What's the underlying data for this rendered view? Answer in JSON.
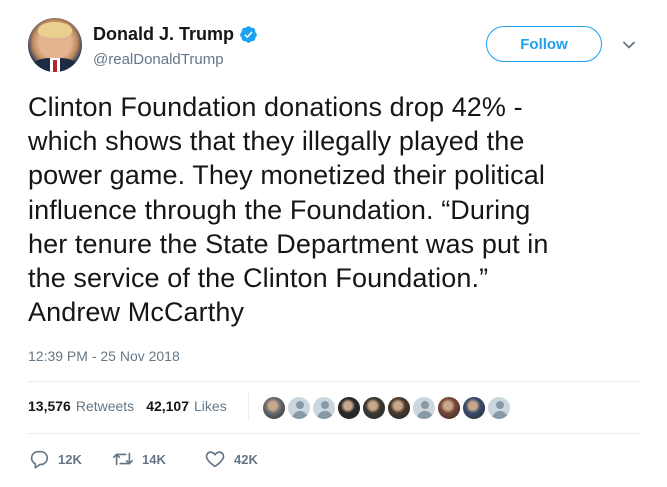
{
  "header": {
    "display_name": "Donald J. Trump",
    "handle": "@realDonaldTrump",
    "follow_label": "Follow",
    "verified": true
  },
  "tweet": {
    "lines": [
      "Clinton Foundation donations drop 42% -",
      "which shows that they illegally played the",
      "power game. They monetized their political",
      "influence through the Foundation. “During",
      "her tenure the State Department was put in",
      "the service of the Clinton Foundation.”",
      "Andrew McCarthy"
    ],
    "timestamp": "12:39 PM - 25 Nov 2018"
  },
  "stats": {
    "retweets_count": "13,576",
    "retweets_label": "Retweets",
    "likes_count": "42,107",
    "likes_label": "Likes"
  },
  "liker_avatars": [
    {
      "kind": "photo",
      "color": "#6b6e73"
    },
    {
      "kind": "default"
    },
    {
      "kind": "default"
    },
    {
      "kind": "photo",
      "color": "#2a2a2a"
    },
    {
      "kind": "photo",
      "color": "#3d3a33"
    },
    {
      "kind": "photo",
      "color": "#4a3b2c"
    },
    {
      "kind": "default"
    },
    {
      "kind": "photo",
      "color": "#7a4a3a"
    },
    {
      "kind": "photo",
      "color": "#3b4f6e"
    },
    {
      "kind": "default"
    }
  ],
  "actions": {
    "reply_count": "12K",
    "retweet_count": "14K",
    "like_count": "42K"
  },
  "colors": {
    "accent": "#1da1f2",
    "text": "#14171a",
    "muted": "#657786"
  }
}
